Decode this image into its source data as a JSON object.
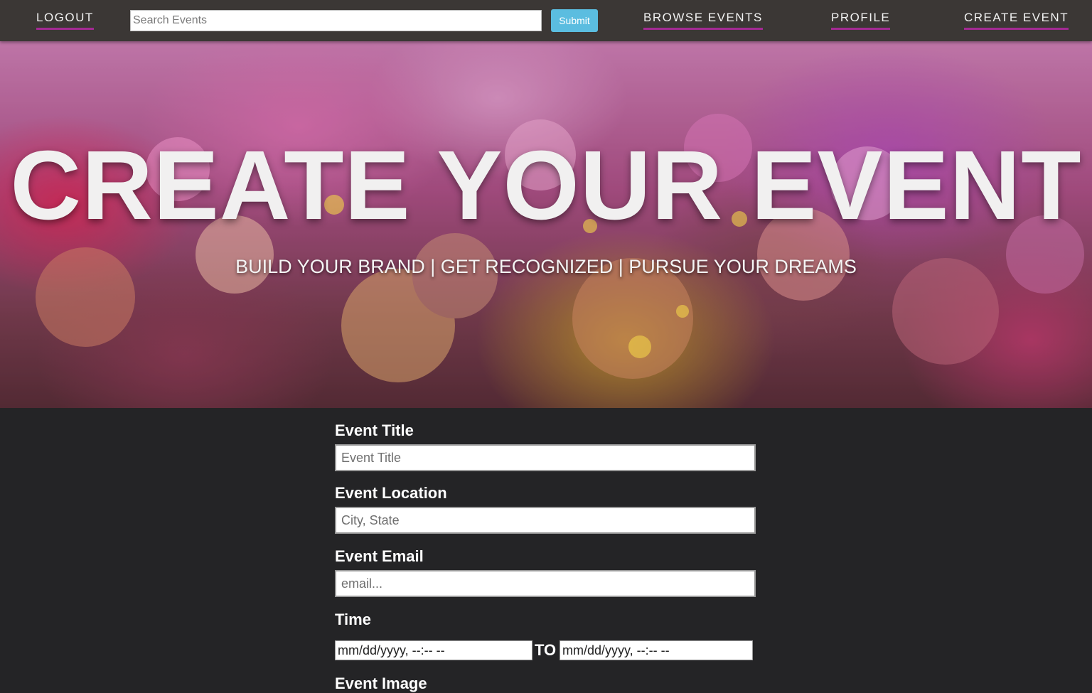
{
  "nav": {
    "logout_label": "LOGOUT",
    "search_placeholder": "Search Events",
    "submit_label": "Submit",
    "browse_label": "BROWSE EVENTS",
    "profile_label": "PROFILE",
    "create_label": "CREATE EVENT"
  },
  "hero": {
    "title": "CREATE YOUR EVENT",
    "subtitle": "BUILD YOUR BRAND | GET RECOGNIZED | PURSUE YOUR DREAMS"
  },
  "form": {
    "title_label": "Event Title",
    "title_placeholder": "Event Title",
    "location_label": "Event Location",
    "location_placeholder": "City, State",
    "email_label": "Event Email",
    "email_placeholder": "email...",
    "time_label": "Time",
    "time_start_placeholder": "mm/dd/yyyy, --:-- --",
    "time_separator": "TO",
    "time_end_placeholder": "mm/dd/yyyy, --:-- --",
    "image_label": "Event Image"
  },
  "colors": {
    "nav_background": "#3b3735",
    "nav_underline": "#a32a93",
    "submit_button": "#5bbde0",
    "page_background": "#242426"
  }
}
